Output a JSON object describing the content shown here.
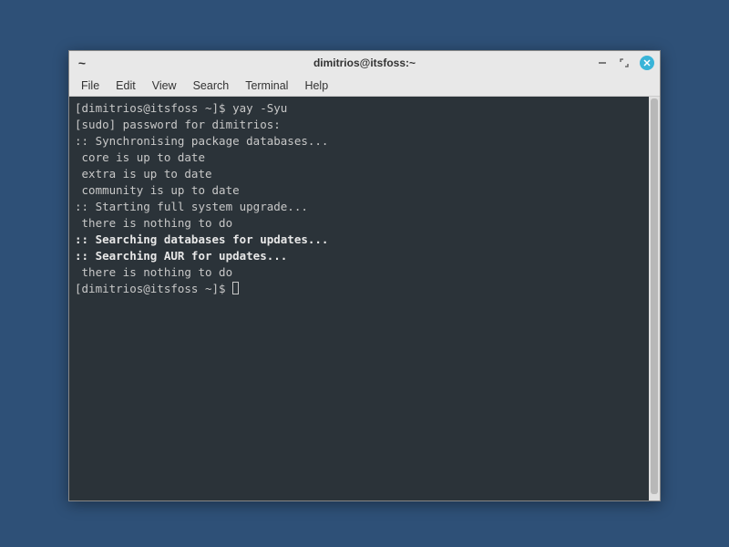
{
  "window": {
    "title": "dimitrios@itsfoss:~",
    "app_icon": "~"
  },
  "menubar": {
    "items": [
      "File",
      "Edit",
      "View",
      "Search",
      "Terminal",
      "Help"
    ]
  },
  "terminal": {
    "lines": [
      {
        "text": "[dimitrios@itsfoss ~]$ yay -Syu",
        "bold": false
      },
      {
        "text": "[sudo] password for dimitrios:",
        "bold": false
      },
      {
        "text": ":: Synchronising package databases...",
        "bold": false
      },
      {
        "text": " core is up to date",
        "bold": false
      },
      {
        "text": " extra is up to date",
        "bold": false
      },
      {
        "text": " community is up to date",
        "bold": false
      },
      {
        "text": ":: Starting full system upgrade...",
        "bold": false
      },
      {
        "text": " there is nothing to do",
        "bold": false
      },
      {
        "text": ":: Searching databases for updates...",
        "bold": true
      },
      {
        "text": ":: Searching AUR for updates...",
        "bold": true
      },
      {
        "text": " there is nothing to do",
        "bold": false
      }
    ],
    "prompt": "[dimitrios@itsfoss ~]$ "
  }
}
